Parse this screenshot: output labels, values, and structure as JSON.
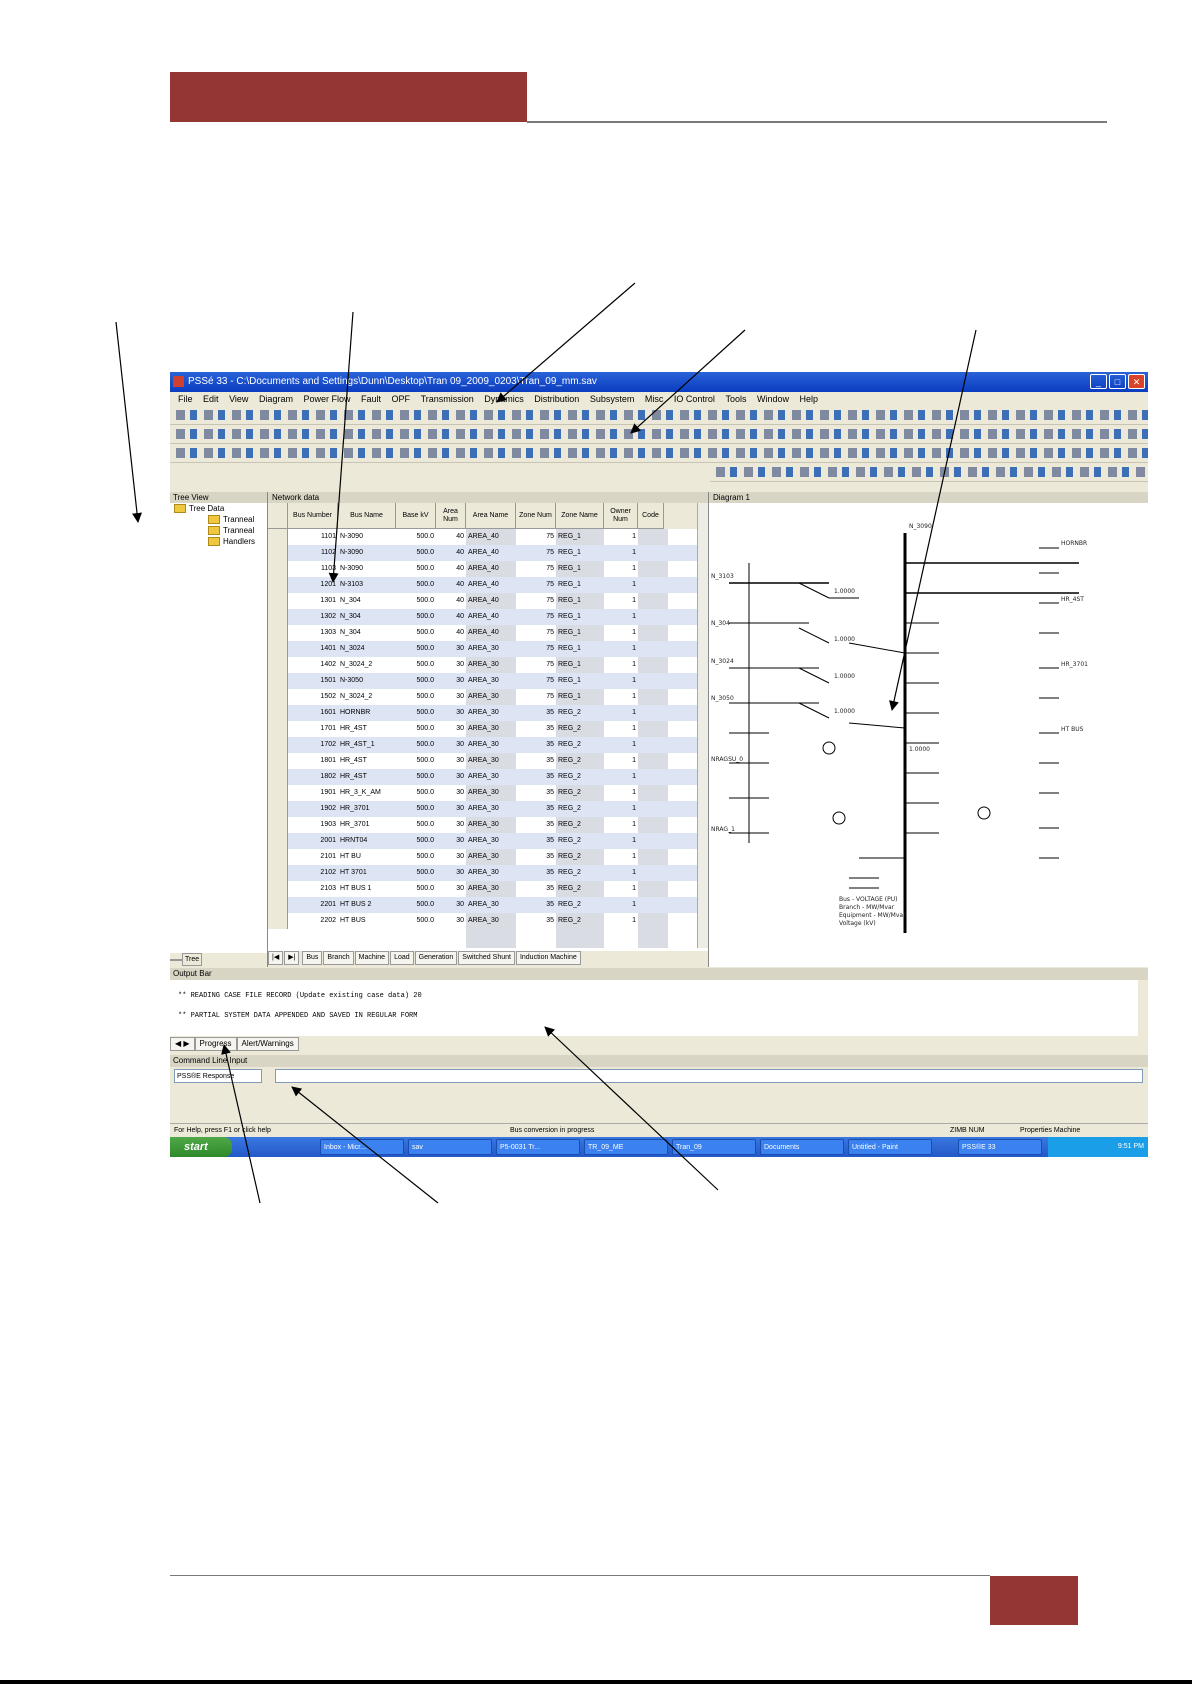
{
  "colors": {
    "accent": "#943634",
    "xp_title": "#0a3cc0",
    "row_alt": "#dde4f4"
  },
  "window": {
    "title": "PSSé 33 - C:\\Documents and Settings\\Dunn\\Desktop\\Tran 09_2009_0203\\Tran_09_mm.sav"
  },
  "menu": [
    "File",
    "Edit",
    "View",
    "Diagram",
    "Power Flow",
    "Fault",
    "OPF",
    "Transmission",
    "Dynamics",
    "Distribution",
    "Subsystem",
    "Misc",
    "IO Control",
    "Tools",
    "Window",
    "Help"
  ],
  "left_pane": {
    "title": "Tree View",
    "root": "Tree Data",
    "items": [
      "Tranneal",
      "Tranneal",
      "Handlers"
    ],
    "tabs": [
      "",
      "",
      "Tree"
    ]
  },
  "spreadsheet": {
    "tab": "Network data",
    "headers": [
      "Bus Number",
      "Bus Name",
      "Base kV",
      "Area Num",
      "Area Name",
      "Zone Num",
      "Zone Name",
      "Owner Num",
      "Code"
    ],
    "rows": [
      [
        "1101",
        "N-3090",
        "500.0",
        "40",
        "AREA_40",
        "75",
        "REG_1",
        "1",
        ""
      ],
      [
        "1102",
        "N-3090",
        "500.0",
        "40",
        "AREA_40",
        "75",
        "REG_1",
        "1",
        ""
      ],
      [
        "1103",
        "N-3090",
        "500.0",
        "40",
        "AREA_40",
        "75",
        "REG_1",
        "1",
        ""
      ],
      [
        "1201",
        "N-3103",
        "500.0",
        "40",
        "AREA_40",
        "75",
        "REG_1",
        "1",
        ""
      ],
      [
        "1301",
        "N_304",
        "500.0",
        "40",
        "AREA_40",
        "75",
        "REG_1",
        "1",
        ""
      ],
      [
        "1302",
        "N_304",
        "500.0",
        "40",
        "AREA_40",
        "75",
        "REG_1",
        "1",
        ""
      ],
      [
        "1303",
        "N_304",
        "500.0",
        "40",
        "AREA_40",
        "75",
        "REG_1",
        "1",
        ""
      ],
      [
        "1401",
        "N_3024",
        "500.0",
        "30",
        "AREA_30",
        "75",
        "REG_1",
        "1",
        ""
      ],
      [
        "1402",
        "N_3024_2",
        "500.0",
        "30",
        "AREA_30",
        "75",
        "REG_1",
        "1",
        ""
      ],
      [
        "1501",
        "N-3050",
        "500.0",
        "30",
        "AREA_30",
        "75",
        "REG_1",
        "1",
        ""
      ],
      [
        "1502",
        "N_3024_2",
        "500.0",
        "30",
        "AREA_30",
        "75",
        "REG_1",
        "1",
        ""
      ],
      [
        "1601",
        "HORNBR",
        "500.0",
        "30",
        "AREA_30",
        "35",
        "REG_2",
        "1",
        ""
      ],
      [
        "1701",
        "HR_4ST",
        "500.0",
        "30",
        "AREA_30",
        "35",
        "REG_2",
        "1",
        ""
      ],
      [
        "1702",
        "HR_4ST_1",
        "500.0",
        "30",
        "AREA_30",
        "35",
        "REG_2",
        "1",
        ""
      ],
      [
        "1801",
        "HR_4ST",
        "500.0",
        "30",
        "AREA_30",
        "35",
        "REG_2",
        "1",
        ""
      ],
      [
        "1802",
        "HR_4ST",
        "500.0",
        "30",
        "AREA_30",
        "35",
        "REG_2",
        "1",
        ""
      ],
      [
        "1901",
        "HR_3_K_AM",
        "500.0",
        "30",
        "AREA_30",
        "35",
        "REG_2",
        "1",
        ""
      ],
      [
        "1902",
        "HR_3701",
        "500.0",
        "30",
        "AREA_30",
        "35",
        "REG_2",
        "1",
        ""
      ],
      [
        "1903",
        "HR_3701",
        "500.0",
        "30",
        "AREA_30",
        "35",
        "REG_2",
        "1",
        ""
      ],
      [
        "2001",
        "HRNT04",
        "500.0",
        "30",
        "AREA_30",
        "35",
        "REG_2",
        "1",
        ""
      ],
      [
        "2101",
        "HT BU",
        "500.0",
        "30",
        "AREA_30",
        "35",
        "REG_2",
        "1",
        ""
      ],
      [
        "2102",
        "HT 3701",
        "500.0",
        "30",
        "AREA_30",
        "35",
        "REG_2",
        "1",
        ""
      ],
      [
        "2103",
        "HT BUS 1",
        "500.0",
        "30",
        "AREA_30",
        "35",
        "REG_2",
        "1",
        ""
      ],
      [
        "2201",
        "HT BUS 2",
        "500.0",
        "30",
        "AREA_30",
        "35",
        "REG_2",
        "1",
        ""
      ],
      [
        "2202",
        "HT BUS",
        "500.0",
        "30",
        "AREA_30",
        "35",
        "REG_2",
        "1",
        ""
      ]
    ],
    "sheet_tabs": [
      "Bus",
      "Branch",
      "Machine",
      "Load",
      "Generation",
      "Switched Shunt",
      "Induction Machine"
    ]
  },
  "diagram": {
    "tab": "Diagram 1",
    "bus_labels": [
      "N_3090",
      "N_3103",
      "N_304",
      "N_3024",
      "N_3050",
      "HORNBR",
      "HR_4ST",
      "HR_3701",
      "HT BUS",
      "NRAGSU_0",
      "NRAG_1"
    ],
    "value_labels": [
      "1.0000",
      "1.0000",
      "1.0000",
      "1.0000",
      "1.0000"
    ],
    "legend": [
      "Bus - VOLTAGE (PU)",
      "Branch - MW/Mvar",
      "Equipment - MW/Mvar",
      "Voltage (kV)"
    ]
  },
  "messages": {
    "title": "Output Bar",
    "lines": [
      "** READING CASE FILE RECORD (Update existing case data) 20",
      "** PARTIAL SYSTEM DATA APPENDED AND SAVED IN REGULAR FORM"
    ],
    "tabs": [
      "Progress",
      "Alert/Warnings"
    ]
  },
  "command": {
    "title": "Command Line Input",
    "mode": "PSS®E Response"
  },
  "status": {
    "left": "For Help, press F1 or click help",
    "center": "Bus conversion in progress",
    "right1": "ZIMB NUM",
    "right2": "Properties  Machine"
  },
  "taskbar": {
    "start": "start",
    "items": [
      "Inbox - Micr...",
      "sav",
      "P5-0031 Tr...",
      "TR_09_ME",
      "Tran_09",
      "Documents",
      "Untitled - Paint",
      "PSS®E 33"
    ],
    "clock": "9:51 PM"
  }
}
